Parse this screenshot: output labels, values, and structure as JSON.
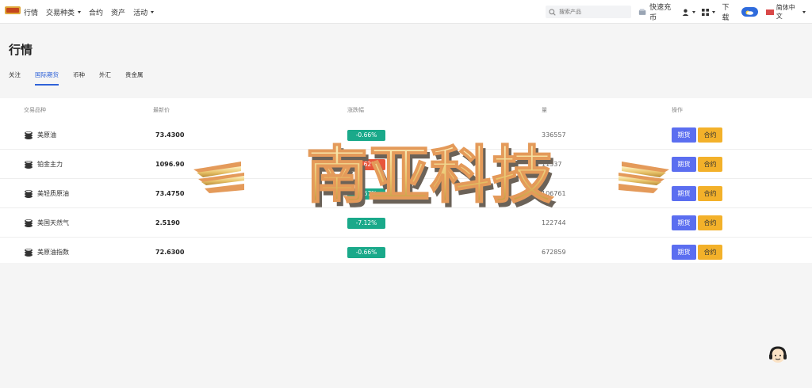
{
  "nav": {
    "items": [
      {
        "label": "行情",
        "dropdown": false
      },
      {
        "label": "交易种类",
        "dropdown": true
      },
      {
        "label": "合约",
        "dropdown": false
      },
      {
        "label": "资产",
        "dropdown": false
      },
      {
        "label": "活动",
        "dropdown": true
      }
    ]
  },
  "search": {
    "placeholder": "搜索产品"
  },
  "tools": {
    "quick_recharge": "快速充币",
    "download": "下载",
    "language": "简体中文"
  },
  "page": {
    "title": "行情"
  },
  "tabs": [
    {
      "label": "关注",
      "active": false
    },
    {
      "label": "国际期货",
      "active": true
    },
    {
      "label": "币种",
      "active": false
    },
    {
      "label": "外汇",
      "active": false
    },
    {
      "label": "贵金属",
      "active": false
    }
  ],
  "table": {
    "headers": {
      "symbol": "交易品种",
      "price": "最新价",
      "change": "涨跌幅",
      "volume": "量",
      "action": "操作"
    },
    "rows": [
      {
        "name": "美原油",
        "price": "73.4300",
        "change": "-0.66%",
        "change_color": "#1aa98a",
        "volume": "336557"
      },
      {
        "name": "铂金主力",
        "price": "1096.90",
        "change": "-0.62%",
        "change_color": "#e8553b",
        "volume": "11537"
      },
      {
        "name": "美轻质原油",
        "price": "73.4750",
        "change": "-0.67%",
        "change_color": "#1aa98a",
        "volume": "106761"
      },
      {
        "name": "美国天然气",
        "price": "2.5190",
        "change": "-7.12%",
        "change_color": "#1aa98a",
        "volume": "122744"
      },
      {
        "name": "美原油指数",
        "price": "72.6300",
        "change": "-0.66%",
        "change_color": "#1aa98a",
        "volume": "672859"
      }
    ],
    "btn_futures": "期货",
    "btn_contract": "合约"
  },
  "watermark": {
    "text": "南亚科技"
  },
  "colors": {
    "accent": "#2f62d8",
    "buy": "#5b6ef0",
    "contract": "#f3b12a",
    "down_green": "#1aa98a"
  }
}
